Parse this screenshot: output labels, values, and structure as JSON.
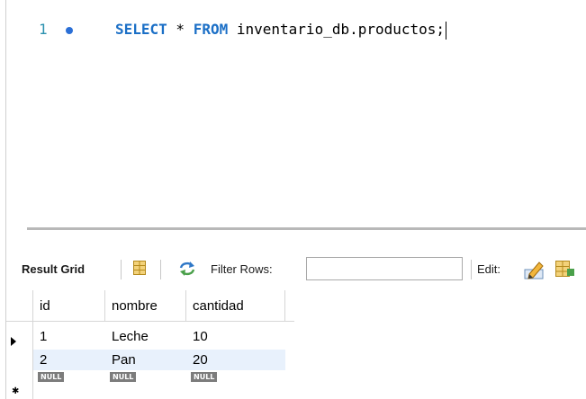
{
  "editor": {
    "line_number": "1",
    "keyword_select": "SELECT",
    "star": " * ",
    "keyword_from": "FROM",
    "table_ref": " inventario_db.productos;"
  },
  "toolbar": {
    "result_grid_label": "Result Grid",
    "filter_label": "Filter Rows:",
    "filter_value": "",
    "edit_label": "Edit:"
  },
  "grid": {
    "columns": [
      "id",
      "nombre",
      "cantidad"
    ],
    "rows": [
      [
        "1",
        "Leche",
        "10"
      ],
      [
        "2",
        "Pan",
        "20"
      ]
    ],
    "new_row": [
      "NULL",
      "NULL",
      "NULL"
    ],
    "new_row_marker": "✱"
  },
  "icons": {
    "grid": "grid-icon",
    "refresh": "refresh-icon",
    "edit": "edit-pencil-icon",
    "more": "table-edit-icon",
    "row_pointer": "row-pointer-icon"
  },
  "colors": {
    "keyword": "#1b6fc6",
    "line_number": "#2b91af",
    "selected_row": "#e8f1fc",
    "null_badge": "#7c7c7c"
  }
}
